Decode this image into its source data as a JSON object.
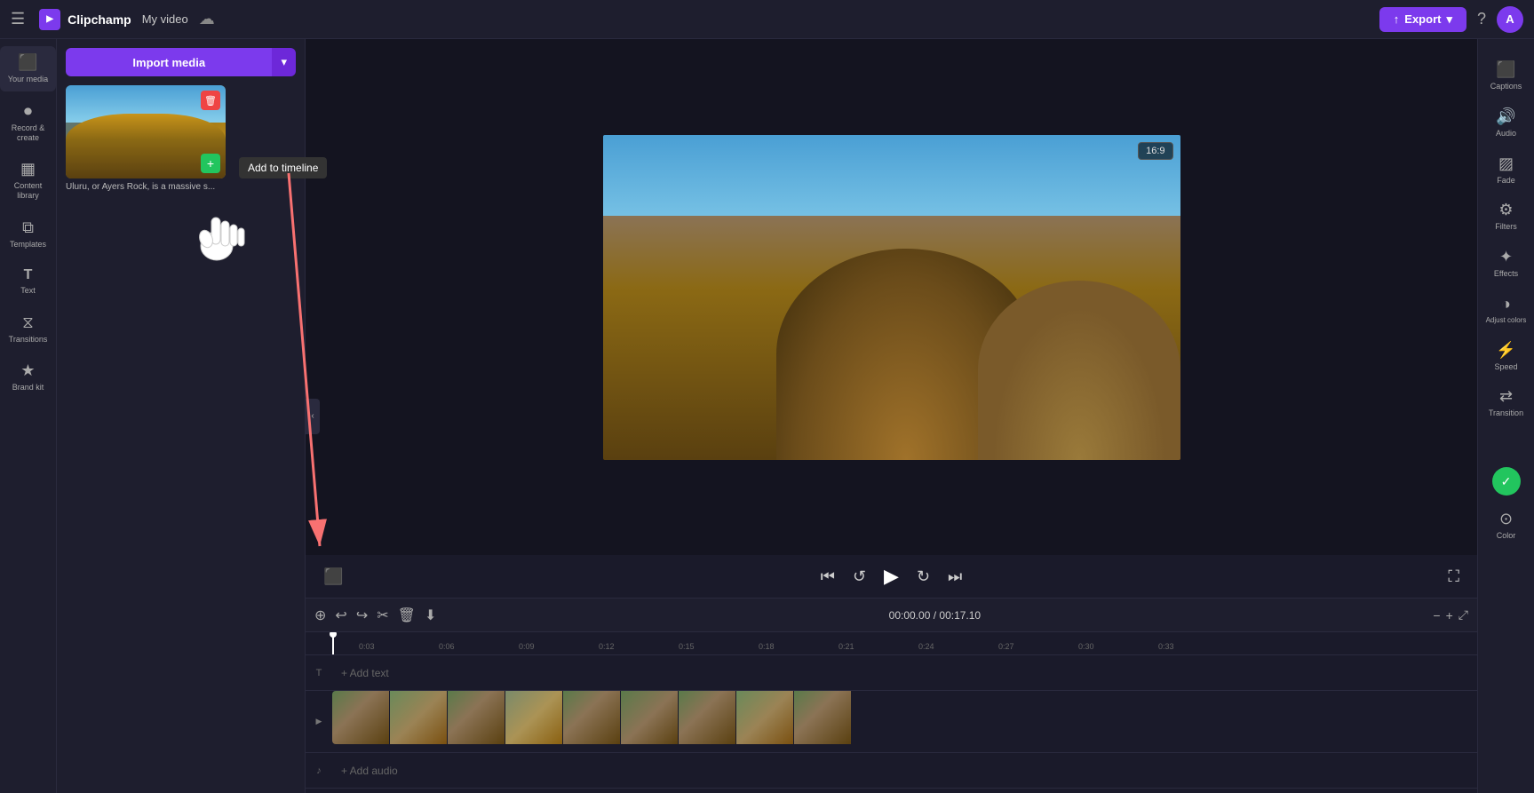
{
  "topbar": {
    "menu_label": "☰",
    "logo_text": "Clipchamp",
    "video_title": "My video",
    "cloud_icon": "☁",
    "export_label": "Export",
    "export_arrow": "▾",
    "help_label": "?",
    "avatar_label": "A"
  },
  "left_sidebar": {
    "items": [
      {
        "id": "your-media",
        "icon": "⬛",
        "label": "Your media"
      },
      {
        "id": "record-create",
        "icon": "⏺",
        "label": "Record & create"
      },
      {
        "id": "content-library",
        "icon": "▦",
        "label": "Content library"
      },
      {
        "id": "templates",
        "icon": "⧉",
        "label": "Templates"
      },
      {
        "id": "text",
        "icon": "T",
        "label": "Text"
      },
      {
        "id": "transitions",
        "icon": "⧖",
        "label": "Transitions"
      },
      {
        "id": "brand-kit",
        "icon": "★",
        "label": "Brand kit"
      }
    ]
  },
  "media_panel": {
    "import_btn_label": "Import media",
    "import_arrow": "▾",
    "media_caption": "Uluru, or Ayers Rock, is a massive s...",
    "tooltip_text": "Add to timeline",
    "delete_icon": "🗑",
    "add_icon": "+"
  },
  "video_preview": {
    "aspect_ratio": "16:9",
    "fullscreen_icon": "⛶"
  },
  "video_controls": {
    "rewind_icon": "⏮",
    "back5_icon": "↺",
    "play_icon": "▶",
    "forward5_icon": "↻",
    "skip_icon": "⏭",
    "subtitle_icon": "▭",
    "fullscreen_icon": "⛶"
  },
  "timeline": {
    "toolbar": {
      "magnet_icon": "⊕",
      "undo_icon": "↩",
      "redo_icon": "↪",
      "cut_icon": "✂",
      "delete_icon": "🗑",
      "save_icon": "⬇"
    },
    "time_current": "00:00.00",
    "time_separator": " / ",
    "time_total": "00:17.10",
    "ruler_marks": [
      "0:03",
      "0:06",
      "0:09",
      "0:12",
      "0:15",
      "0:18",
      "0:21",
      "0:24",
      "0:27",
      "0:30",
      "0:33"
    ],
    "text_track_label": "T",
    "add_text_label": "+ Add text",
    "audio_track_label": "♪",
    "add_audio_label": "+ Add audio",
    "zoom_in_icon": "+",
    "zoom_out_icon": "−",
    "zoom_expand_icon": "⤢"
  },
  "right_sidebar": {
    "check_icon": "✓",
    "captions_label": "Captions",
    "audio_label": "Audio",
    "fade_label": "Fade",
    "filters_label": "Filters",
    "effects_label": "Effects",
    "adjust_label": "Adjust colors",
    "speed_label": "Speed",
    "transition_label": "Transition",
    "color_label": "Color"
  }
}
